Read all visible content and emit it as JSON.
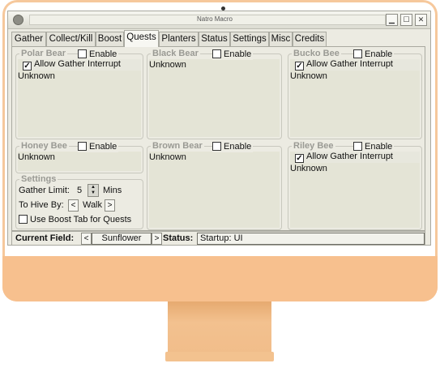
{
  "window": {
    "title": "Natro Macro",
    "minimize_icon": "minimize-icon",
    "maximize_icon": "maximize-icon",
    "close_icon": "close-icon"
  },
  "tabs": [
    {
      "label": "Gather"
    },
    {
      "label": "Collect/Kill"
    },
    {
      "label": "Boost"
    },
    {
      "label": "Quests",
      "active": true
    },
    {
      "label": "Planters"
    },
    {
      "label": "Status"
    },
    {
      "label": "Settings"
    },
    {
      "label": "Misc"
    },
    {
      "label": "Credits"
    }
  ],
  "quests": {
    "polar_bear": {
      "title": "Polar Bear",
      "enable_label": "Enable",
      "enabled": false,
      "interrupt_label": "Allow Gather Interrupt",
      "interrupt_checked": true,
      "status": "Unknown"
    },
    "black_bear": {
      "title": "Black Bear",
      "enable_label": "Enable",
      "enabled": false,
      "status": "Unknown"
    },
    "bucko_bee": {
      "title": "Bucko Bee",
      "enable_label": "Enable",
      "enabled": false,
      "interrupt_label": "Allow Gather Interrupt",
      "interrupt_checked": true,
      "status": "Unknown"
    },
    "honey_bee": {
      "title": "Honey Bee",
      "enable_label": "Enable",
      "enabled": false,
      "status": "Unknown"
    },
    "brown_bear": {
      "title": "Brown Bear",
      "enable_label": "Enable",
      "enabled": false,
      "status": "Unknown"
    },
    "riley_bee": {
      "title": "Riley Bee",
      "enable_label": "Enable",
      "enabled": false,
      "interrupt_label": "Allow Gather Interrupt",
      "interrupt_checked": true,
      "status": "Unknown"
    }
  },
  "settings": {
    "title": "Settings",
    "gather_limit_label": "Gather Limit:",
    "gather_limit_value": "5",
    "gather_limit_unit": "Mins",
    "to_hive_label": "To Hive By:",
    "to_hive_value": "Walk",
    "prev_symbol": "<",
    "next_symbol": ">",
    "boost_tab_label": "Use Boost Tab for Quests",
    "boost_tab_checked": false
  },
  "status_bar": {
    "current_field_label": "Current Field:",
    "current_field_value": "Sunflower",
    "prev_symbol": "<",
    "next_symbol": ">",
    "status_label": "Status:",
    "status_value": "Startup: UI"
  },
  "check_mark": "✓"
}
